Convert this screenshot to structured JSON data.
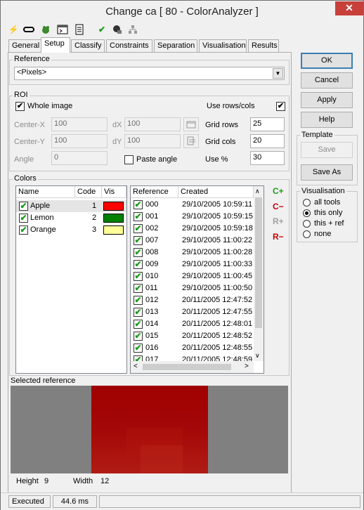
{
  "window": {
    "title": "Change ca [ 80 - ColorAnalyzer ]",
    "close_label": "✕"
  },
  "toolbar": {
    "icons": [
      "lightning-icon",
      "link-icon",
      "frog-icon",
      "console-icon",
      "notepad-icon",
      "checkmark-icon",
      "mask-icon",
      "network-icon"
    ]
  },
  "tabs": [
    "General",
    "Setup",
    "Classify",
    "Constraints",
    "Separation",
    "Visualisation",
    "Results"
  ],
  "active_tab": "Setup",
  "reference": {
    "label": "Reference",
    "value": "<Pixels>"
  },
  "roi": {
    "label": "ROI",
    "whole_image_label": "Whole image",
    "whole_image_checked": true,
    "use_rowscols_label": "Use rows/cols",
    "use_rowscols_checked": true,
    "center_x_label": "Center-X",
    "center_x": "100",
    "center_y_label": "Center-Y",
    "center_y": "100",
    "angle_label": "Angle",
    "angle": "0",
    "dx_label": "dX",
    "dx": "100",
    "dy_label": "dY",
    "dy": "100",
    "paste_angle_label": "Paste angle",
    "paste_angle_checked": false,
    "grid_rows_label": "Grid rows",
    "grid_rows": "25",
    "grid_cols_label": "Grid cols",
    "grid_cols": "20",
    "use_pct_label": "Use %",
    "use_pct": "30"
  },
  "colors": {
    "label": "Colors",
    "headers": [
      "Name",
      "Code",
      "Vis"
    ],
    "items": [
      {
        "name": "Apple",
        "code": "1",
        "vis_color": "#ff0000",
        "checked": true
      },
      {
        "name": "Lemon",
        "code": "2",
        "vis_color": "#008000",
        "checked": true
      },
      {
        "name": "Orange",
        "code": "3",
        "vis_color": "#ffff99",
        "checked": true
      }
    ],
    "add_label": "C+",
    "remove_label": "C−",
    "ref_add_label": "R+",
    "ref_remove_label": "R−"
  },
  "references": {
    "headers": [
      "Reference",
      "Created"
    ],
    "items": [
      {
        "ref": "000",
        "created": "29/10/2005 10:59:11"
      },
      {
        "ref": "001",
        "created": "29/10/2005 10:59:15"
      },
      {
        "ref": "002",
        "created": "29/10/2005 10:59:18"
      },
      {
        "ref": "007",
        "created": "29/10/2005 11:00:22"
      },
      {
        "ref": "008",
        "created": "29/10/2005 11:00:28"
      },
      {
        "ref": "009",
        "created": "29/10/2005 11:00:33"
      },
      {
        "ref": "010",
        "created": "29/10/2005 11:00:45"
      },
      {
        "ref": "011",
        "created": "29/10/2005 11:00:50"
      },
      {
        "ref": "012",
        "created": "20/11/2005 12:47:52"
      },
      {
        "ref": "013",
        "created": "20/11/2005 12:47:55"
      },
      {
        "ref": "014",
        "created": "20/11/2005 12:48:01"
      },
      {
        "ref": "015",
        "created": "20/11/2005 12:48:52"
      },
      {
        "ref": "016",
        "created": "20/11/2005 12:48:55"
      },
      {
        "ref": "017",
        "created": "20/11/2005 12:48:59"
      }
    ]
  },
  "selected_reference": {
    "label": "Selected reference",
    "height_label": "Height",
    "height": "9",
    "width_label": "Width",
    "width": "12"
  },
  "buttons": {
    "ok": "OK",
    "cancel": "Cancel",
    "apply": "Apply",
    "help": "Help"
  },
  "template": {
    "label": "Template",
    "save": "Save",
    "save_as": "Save As"
  },
  "visualisation": {
    "label": "Visualisation",
    "options": [
      "all tools",
      "this only",
      "this + ref",
      "none"
    ],
    "selected": "this only"
  },
  "status": {
    "state": "Executed",
    "time": "44.6 ms"
  },
  "colors_theme": {
    "check_green": "#1a9b1a",
    "accent_red": "#cc0000",
    "accent_green": "#1a9b1a",
    "swatch_dark_red": "#a00000",
    "gray_bg": "#808080"
  }
}
